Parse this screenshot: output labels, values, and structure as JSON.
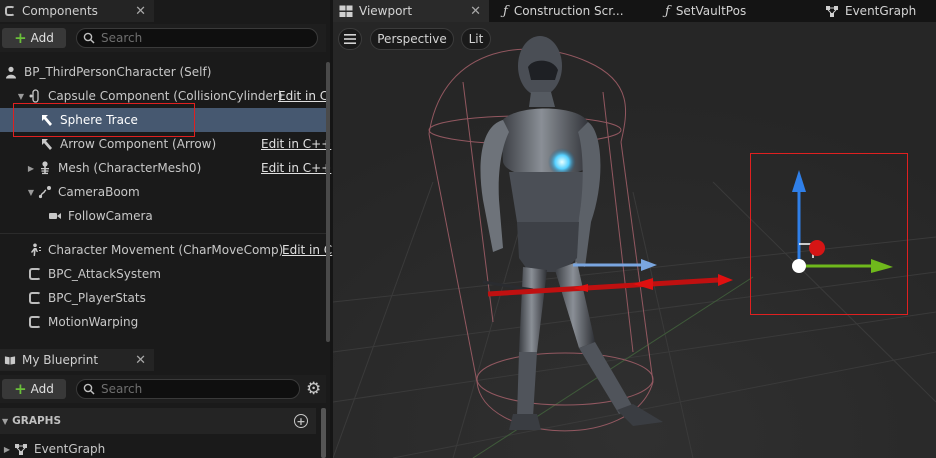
{
  "components_panel": {
    "tab_title": "Components",
    "add_label": "Add",
    "search_placeholder": "Search",
    "tree": [
      {
        "label": "BP_ThirdPersonCharacter (Self)"
      },
      {
        "label": "Capsule Component (CollisionCylinder)",
        "edit": "Edit in C"
      },
      {
        "label": "Sphere Trace",
        "selected": true
      },
      {
        "label": "Arrow Component (Arrow)",
        "edit": "Edit in C++"
      },
      {
        "label": "Mesh (CharacterMesh0)",
        "edit": "Edit in C++"
      },
      {
        "label": "CameraBoom"
      },
      {
        "label": "FollowCamera"
      },
      {
        "label": "Character Movement (CharMoveComp)",
        "edit": "Edit in C"
      },
      {
        "label": "BPC_AttackSystem"
      },
      {
        "label": "BPC_PlayerStats"
      },
      {
        "label": "MotionWarping"
      }
    ]
  },
  "blueprint_panel": {
    "tab_title": "My Blueprint",
    "add_label": "Add",
    "search_placeholder": "Search",
    "graphs_header": "GRAPHS",
    "graph_items": [
      "EventGraph"
    ]
  },
  "editor_tabs": [
    {
      "label": "Viewport",
      "icon": "viewport-grid-icon",
      "active": true
    },
    {
      "label": "Construction Scr...",
      "icon": "function-icon"
    },
    {
      "label": "SetVaultPos",
      "icon": "function-icon"
    },
    {
      "label": "EventGraph",
      "icon": "graph-nodes-icon"
    }
  ],
  "viewport": {
    "perspective_label": "Perspective",
    "lit_label": "Lit"
  },
  "colors": {
    "selection": "#465870",
    "highlight_box": "#e02020",
    "add_plus": "#6abf3a",
    "gizmo_z": "#2f7fe8",
    "gizmo_y": "#6fb81c",
    "gizmo_x": "#e01010"
  }
}
